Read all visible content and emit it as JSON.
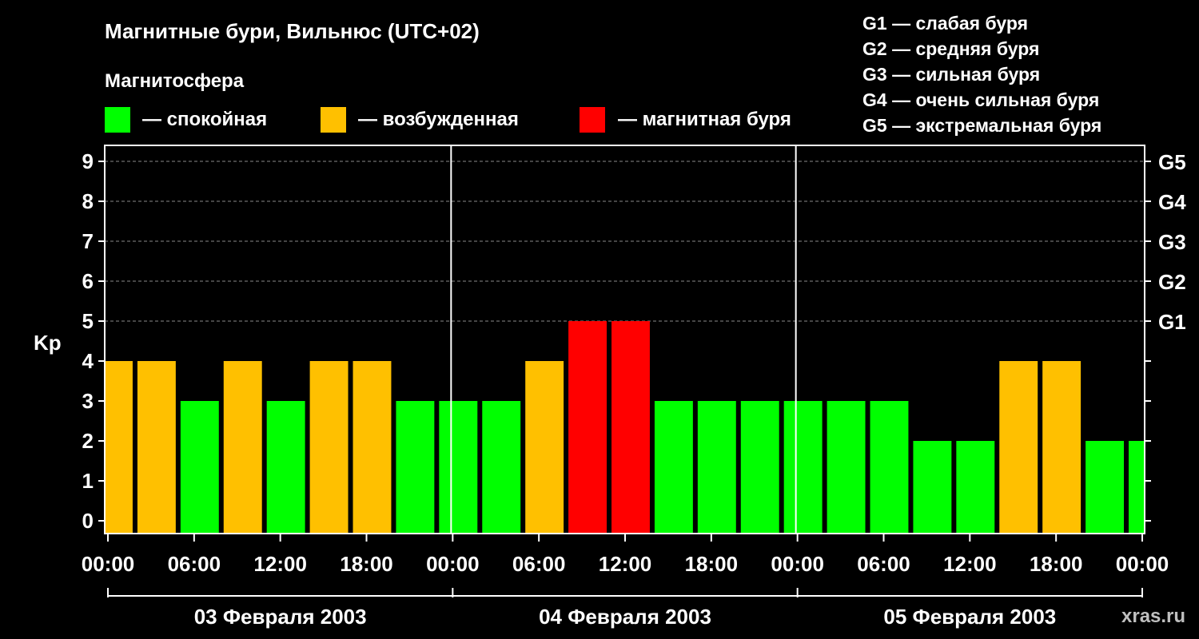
{
  "header": {
    "title": "Магнитные бури, Вильнюс (UTC+02)",
    "legend_title": "Магнитосфера"
  },
  "legend": [
    {
      "label": "— спокойная",
      "color": "#00ff00"
    },
    {
      "label": "— возбужденная",
      "color": "#ffc000"
    },
    {
      "label": "— магнитная буря",
      "color": "#ff0000"
    }
  ],
  "scale_legend": [
    "G1 — слабая буря",
    "G2 — средняя буря",
    "G3 — сильная буря",
    "G4 — очень сильная буря",
    "G5 — экстремальная буря"
  ],
  "watermark": "xras.ru",
  "chart_data": {
    "type": "bar",
    "title": "Магнитные бури, Вильнюс (UTC+02)",
    "ylabel": "Kp",
    "ylim": [
      0,
      9
    ],
    "y_ticks": [
      "0",
      "1",
      "2",
      "3",
      "4",
      "5",
      "6",
      "7",
      "8",
      "9"
    ],
    "right_ticks": [
      {
        "y": 5,
        "label": "G1"
      },
      {
        "y": 6,
        "label": "G2"
      },
      {
        "y": 7,
        "label": "G3"
      },
      {
        "y": 8,
        "label": "G4"
      },
      {
        "y": 9,
        "label": "G5"
      }
    ],
    "x_unit_hours": true,
    "x_range": [
      0,
      72
    ],
    "x_ticks": [
      {
        "x": 0,
        "label": "00:00"
      },
      {
        "x": 6,
        "label": "06:00"
      },
      {
        "x": 12,
        "label": "12:00"
      },
      {
        "x": 18,
        "label": "18:00"
      },
      {
        "x": 24,
        "label": "00:00"
      },
      {
        "x": 30,
        "label": "06:00"
      },
      {
        "x": 36,
        "label": "12:00"
      },
      {
        "x": 42,
        "label": "18:00"
      },
      {
        "x": 48,
        "label": "00:00"
      },
      {
        "x": 54,
        "label": "06:00"
      },
      {
        "x": 60,
        "label": "12:00"
      },
      {
        "x": 66,
        "label": "18:00"
      },
      {
        "x": 72,
        "label": "00:00"
      }
    ],
    "days": [
      {
        "start": 0,
        "end": 24,
        "label": "03 Февраля 2003"
      },
      {
        "start": 24,
        "end": 48,
        "label": "04 Февраля 2003"
      },
      {
        "start": 48,
        "end": 72,
        "label": "05 Февраля 2003"
      }
    ],
    "day_separators": [
      24,
      48
    ],
    "colors": {
      "quiet": "#00ff00",
      "active": "#ffc000",
      "storm": "#ff0000"
    },
    "bars": [
      {
        "start": -1,
        "end": 2,
        "value": 4,
        "level": "active"
      },
      {
        "start": 2,
        "end": 5,
        "value": 4,
        "level": "active"
      },
      {
        "start": 5,
        "end": 8,
        "value": 3,
        "level": "quiet"
      },
      {
        "start": 8,
        "end": 11,
        "value": 4,
        "level": "active"
      },
      {
        "start": 11,
        "end": 14,
        "value": 3,
        "level": "quiet"
      },
      {
        "start": 14,
        "end": 17,
        "value": 4,
        "level": "active"
      },
      {
        "start": 17,
        "end": 20,
        "value": 4,
        "level": "active"
      },
      {
        "start": 20,
        "end": 23,
        "value": 3,
        "level": "quiet"
      },
      {
        "start": 23,
        "end": 26,
        "value": 3,
        "level": "quiet"
      },
      {
        "start": 26,
        "end": 29,
        "value": 3,
        "level": "quiet"
      },
      {
        "start": 29,
        "end": 32,
        "value": 4,
        "level": "active"
      },
      {
        "start": 32,
        "end": 35,
        "value": 5,
        "level": "storm"
      },
      {
        "start": 35,
        "end": 38,
        "value": 5,
        "level": "storm"
      },
      {
        "start": 38,
        "end": 41,
        "value": 3,
        "level": "quiet"
      },
      {
        "start": 41,
        "end": 44,
        "value": 3,
        "level": "quiet"
      },
      {
        "start": 44,
        "end": 47,
        "value": 3,
        "level": "quiet"
      },
      {
        "start": 47,
        "end": 50,
        "value": 3,
        "level": "quiet"
      },
      {
        "start": 50,
        "end": 53,
        "value": 3,
        "level": "quiet"
      },
      {
        "start": 53,
        "end": 56,
        "value": 3,
        "level": "quiet"
      },
      {
        "start": 56,
        "end": 59,
        "value": 2,
        "level": "quiet"
      },
      {
        "start": 59,
        "end": 62,
        "value": 2,
        "level": "quiet"
      },
      {
        "start": 62,
        "end": 65,
        "value": 4,
        "level": "active"
      },
      {
        "start": 65,
        "end": 68,
        "value": 4,
        "level": "active"
      },
      {
        "start": 68,
        "end": 71,
        "value": 2,
        "level": "quiet"
      },
      {
        "start": 71,
        "end": 74,
        "value": 2,
        "level": "quiet"
      }
    ]
  }
}
